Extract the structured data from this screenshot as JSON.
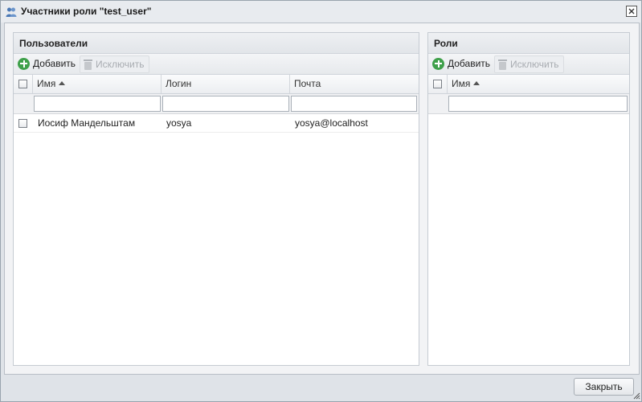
{
  "window": {
    "title": "Участники роли \"test_user\""
  },
  "users_panel": {
    "title": "Пользователи",
    "toolbar": {
      "add_label": "Добавить",
      "remove_label": "Исключить"
    },
    "columns": [
      "Имя",
      "Логин",
      "Почта"
    ],
    "rows": [
      {
        "name": "Иосиф Мандельштам",
        "login": "yosya",
        "email": "yosya@localhost"
      }
    ]
  },
  "roles_panel": {
    "title": "Роли",
    "toolbar": {
      "add_label": "Добавить",
      "remove_label": "Исключить"
    },
    "columns": [
      "Имя"
    ]
  },
  "footer": {
    "close_label": "Закрыть"
  },
  "colors": {
    "add_icon": "#3fa04a",
    "background": "#dfe3e8"
  }
}
